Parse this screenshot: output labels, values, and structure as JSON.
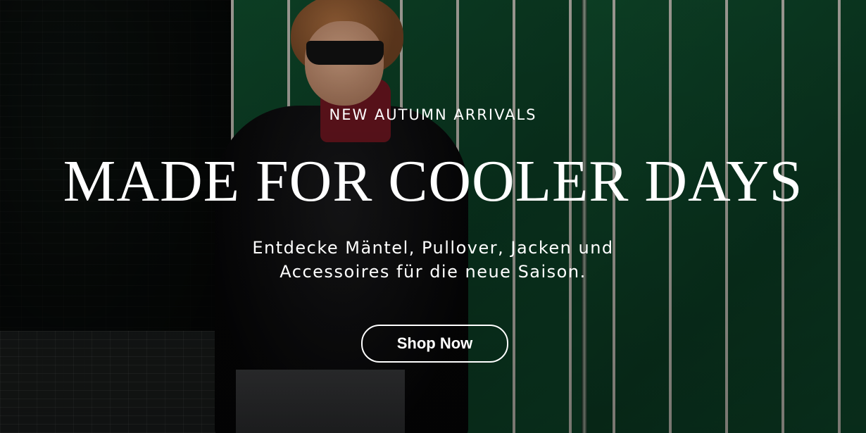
{
  "hero": {
    "eyebrow": "NEW AUTUMN ARRIVALS",
    "headline": "MADE FOR COOLER DAYS",
    "subtext_line1": "Entdecke Mäntel, Pullover, Jacken und",
    "subtext_line2": "Accessoires für die neue Saison.",
    "cta_label": "Shop Now"
  },
  "colors": {
    "tile_green": "#0f4a2b",
    "grout": "#b9b6ad",
    "text": "#ffffff"
  }
}
